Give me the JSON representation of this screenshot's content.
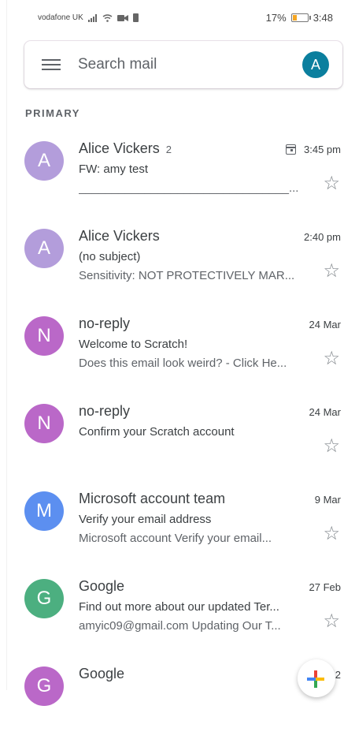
{
  "status_bar": {
    "carrier": "vodafone UK",
    "battery_percent": "17%",
    "time": "3:48"
  },
  "search": {
    "placeholder": "Search mail",
    "account_initial": "A"
  },
  "section": {
    "label": "PRIMARY"
  },
  "emails": [
    {
      "initial": "A",
      "avatar_color": "#b39ddb",
      "sender": "Alice Vickers",
      "count": "2",
      "date": "3:45 pm",
      "has_calendar": true,
      "subject": "FW: amy test",
      "snippet": "________________________________..."
    },
    {
      "initial": "A",
      "avatar_color": "#b39ddb",
      "sender": "Alice Vickers",
      "count": "",
      "date": "2:40 pm",
      "has_calendar": false,
      "subject": "(no subject)",
      "snippet": "Sensitivity: NOT PROTECTIVELY MAR..."
    },
    {
      "initial": "N",
      "avatar_color": "#ba68c8",
      "sender": "no-reply",
      "count": "",
      "date": "24 Mar",
      "has_calendar": false,
      "subject": "Welcome to Scratch!",
      "snippet": "Does this email look weird? - Click He..."
    },
    {
      "initial": "N",
      "avatar_color": "#ba68c8",
      "sender": "no-reply",
      "count": "",
      "date": "24 Mar",
      "has_calendar": false,
      "subject": "Confirm your Scratch account",
      "snippet": ""
    },
    {
      "initial": "M",
      "avatar_color": "#5c8ff0",
      "sender": "Microsoft account team",
      "count": "",
      "date": "9 Mar",
      "has_calendar": false,
      "subject": "Verify your email address",
      "snippet": "Microsoft account Verify your email..."
    },
    {
      "initial": "G",
      "avatar_color": "#4caf80",
      "sender": "Google",
      "count": "",
      "date": "27 Feb",
      "has_calendar": false,
      "subject": "Find out more about our updated Ter...",
      "snippet": "amyic09@gmail.com Updating Our T..."
    },
    {
      "initial": "G",
      "avatar_color": "#ba68c8",
      "sender": "Google",
      "count": "",
      "date": "2",
      "has_calendar": false,
      "subject": "",
      "snippet": ""
    }
  ],
  "icons": {
    "menu": "menu-icon",
    "star": "star-icon",
    "calendar": "calendar-icon",
    "compose": "compose-icon"
  },
  "colors": {
    "account_avatar": "#0b7f9e",
    "star": "#80868b"
  }
}
